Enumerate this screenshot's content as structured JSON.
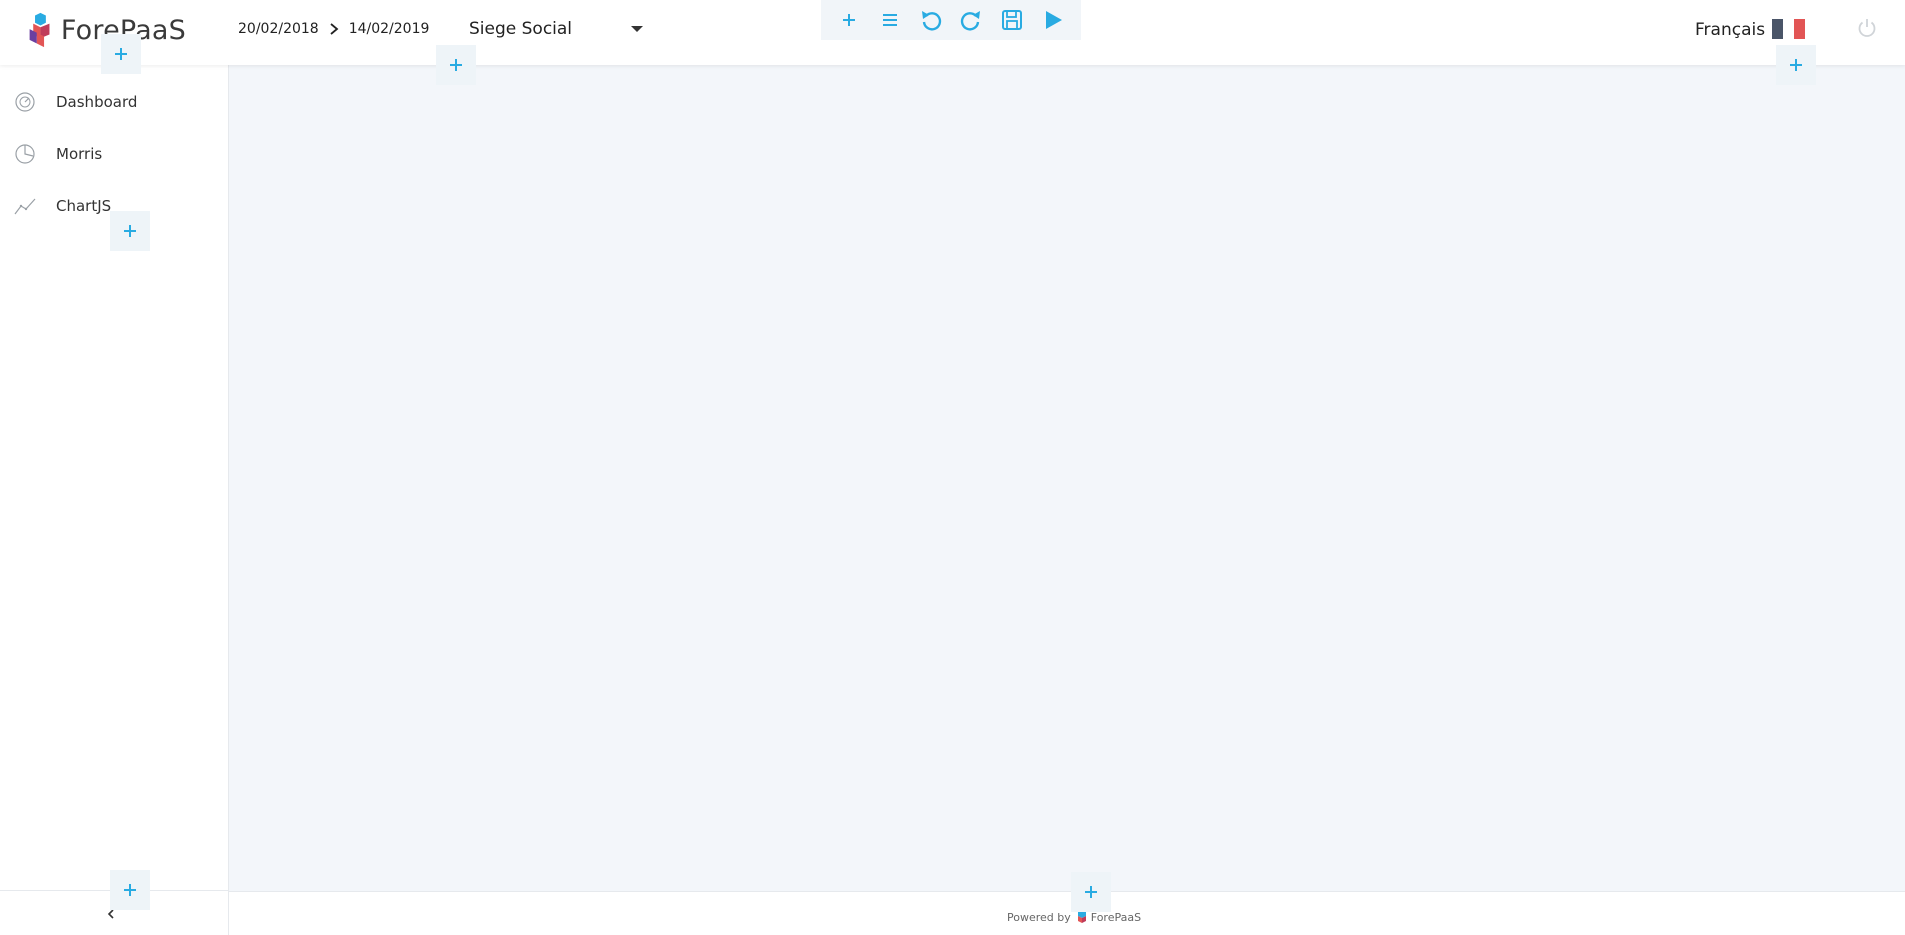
{
  "header": {
    "logo_text": "ForePaaS",
    "date_range": {
      "start": "20/02/2018",
      "end": "14/02/2019"
    },
    "site_select": {
      "selected": "Siege Social"
    },
    "toolbar": {
      "buttons": [
        {
          "name": "add",
          "icon": "plus-icon"
        },
        {
          "name": "menu",
          "icon": "menu-icon"
        },
        {
          "name": "undo",
          "icon": "undo-icon"
        },
        {
          "name": "redo",
          "icon": "redo-icon"
        },
        {
          "name": "save",
          "icon": "save-icon"
        },
        {
          "name": "play",
          "icon": "play-icon"
        }
      ]
    },
    "language": "Français",
    "flag_colors": [
      "#4a5568",
      "#ffffff",
      "#e25555"
    ],
    "power_icon": "power-icon"
  },
  "sidebar": {
    "items": [
      {
        "label": "Dashboard",
        "icon": "gauge-icon"
      },
      {
        "label": "Morris",
        "icon": "pie-chart-icon"
      },
      {
        "label": "ChartJS",
        "icon": "line-chart-icon"
      }
    ],
    "collapse_icon": "chevron-left-icon"
  },
  "footer": {
    "powered_by": "Powered by",
    "brand": "ForePaaS"
  },
  "colors": {
    "accent": "#29abe2",
    "content_bg": "#f3f6fa",
    "add_btn_bg": "#eef4f8",
    "border": "#e6e9ed"
  }
}
